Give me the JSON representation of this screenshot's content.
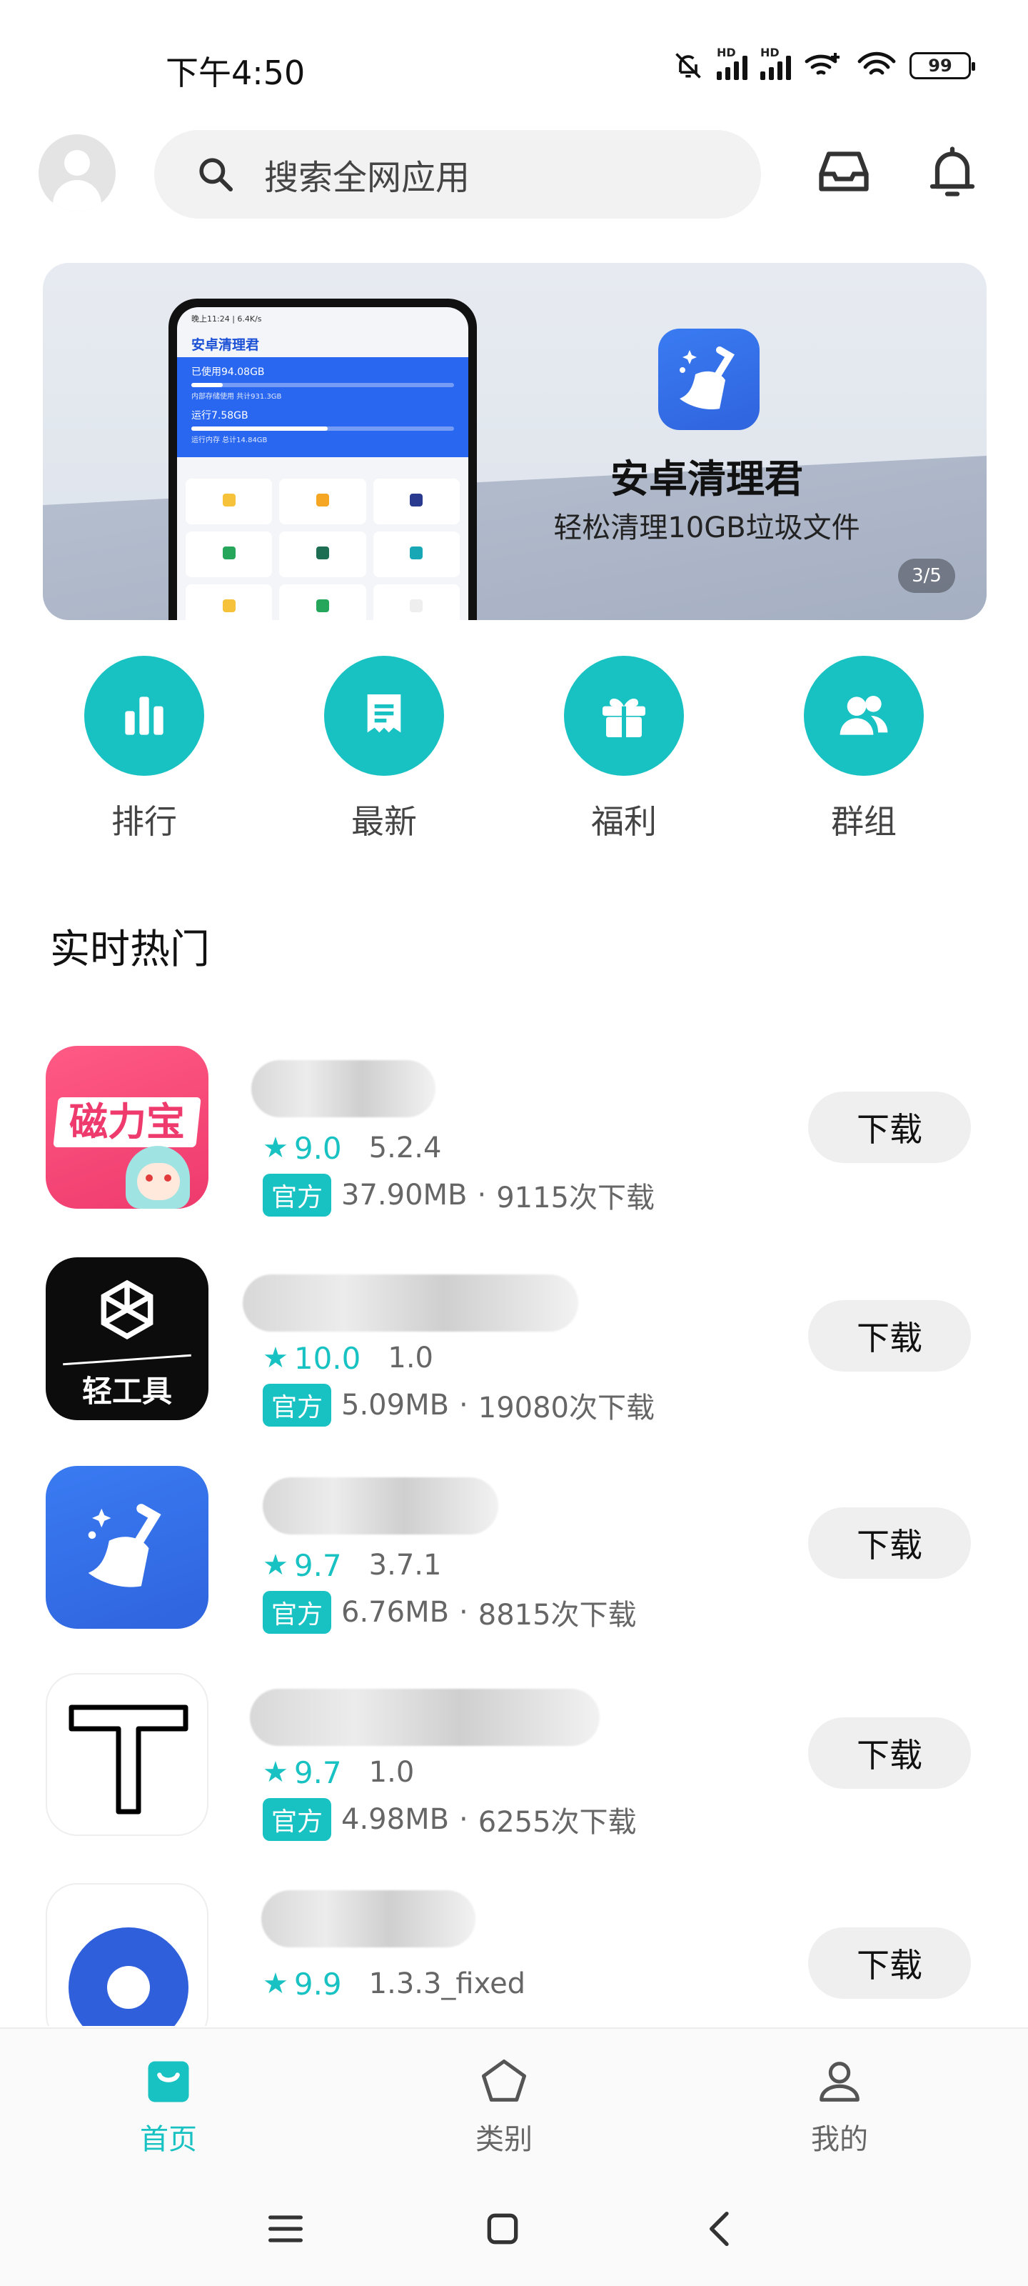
{
  "status_bar": {
    "time": "下午4:50",
    "battery": "99",
    "signal_label_1": "HD",
    "signal_label_2": "HD"
  },
  "header": {
    "search_placeholder": "搜索全网应用"
  },
  "banner": {
    "app_name": "安卓清理君",
    "subtitle": "轻松清理10GB垃圾文件",
    "counter": "3/5",
    "phone_status": "晚上11:24 | 6.4K/s",
    "phone_title": "安卓清理君",
    "phone_used": "已使用94.08GB",
    "phone_storage_note": "内部存储使用 共计931.3GB",
    "phone_ram": "运行7.58GB",
    "phone_ram_note": "运行内存 总计14.84GB"
  },
  "quick_nav": [
    {
      "label": "排行",
      "icon": "bar-chart-icon"
    },
    {
      "label": "最新",
      "icon": "document-icon"
    },
    {
      "label": "福利",
      "icon": "gift-icon"
    },
    {
      "label": "群组",
      "icon": "group-icon"
    }
  ],
  "section": {
    "title": "实时热门"
  },
  "apps": [
    {
      "rating": "9.0",
      "version": "5.2.4",
      "badge": "官方",
      "size": "37.90MB",
      "downloads": "9115次下载",
      "button": "下载",
      "icon_text": "磁力宝"
    },
    {
      "rating": "10.0",
      "version": "1.0",
      "badge": "官方",
      "size": "5.09MB",
      "downloads": "19080次下载",
      "button": "下载",
      "icon_text": "轻工具"
    },
    {
      "rating": "9.7",
      "version": "3.7.1",
      "badge": "官方",
      "size": "6.76MB",
      "downloads": "8815次下载",
      "button": "下载",
      "icon_text": ""
    },
    {
      "rating": "9.7",
      "version": "1.0",
      "badge": "官方",
      "size": "4.98MB",
      "downloads": "6255次下载",
      "button": "下载",
      "icon_text": "T"
    },
    {
      "rating": "9.9",
      "version": "1.3.3_fixed",
      "badge": "",
      "size": "",
      "downloads": "",
      "button": "下载",
      "icon_text": ""
    }
  ],
  "info_separator": "·",
  "tabs": [
    {
      "label": "首页",
      "active": true
    },
    {
      "label": "类别",
      "active": false
    },
    {
      "label": "我的",
      "active": false
    }
  ],
  "colors": {
    "accent": "#18c1c2",
    "banner_blue": "#2f64de"
  }
}
